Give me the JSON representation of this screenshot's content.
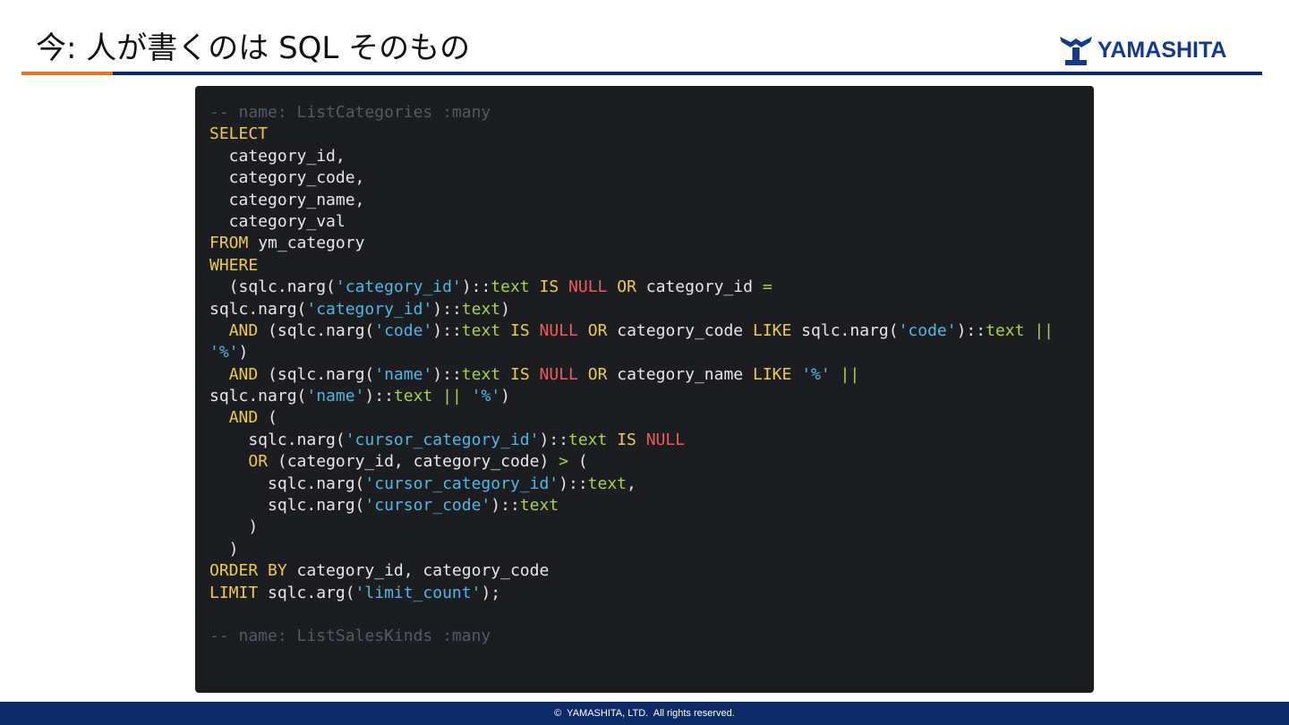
{
  "slide": {
    "title": "今: 人が書くのは SQL そのもの",
    "logo_text": "YAMASHITA",
    "logo_icon": "yamashita-logo-icon"
  },
  "footer": {
    "copyright": "©  YAMASHITA, LTD.  All rights reserved."
  },
  "colors": {
    "header_rule": "#0c2a66",
    "header_accent": "#e8731e",
    "code_background": "#1b1d20",
    "footer_background": "#0c2a66"
  },
  "code": {
    "language": "sql",
    "lines": [
      [
        {
          "t": "-- name: ListCategories :many",
          "k": "comment"
        }
      ],
      [
        {
          "t": "SELECT",
          "k": "keyword"
        }
      ],
      [
        {
          "t": "  category_id,",
          "k": "plain"
        }
      ],
      [
        {
          "t": "  category_code,",
          "k": "plain"
        }
      ],
      [
        {
          "t": "  category_name,",
          "k": "plain"
        }
      ],
      [
        {
          "t": "  category_val",
          "k": "plain"
        }
      ],
      [
        {
          "t": "FROM",
          "k": "keyword"
        },
        {
          "t": " ym_category",
          "k": "plain"
        }
      ],
      [
        {
          "t": "WHERE",
          "k": "keyword"
        }
      ],
      [
        {
          "t": "  (sqlc.narg(",
          "k": "plain"
        },
        {
          "t": "'category_id'",
          "k": "string"
        },
        {
          "t": ")::",
          "k": "plain"
        },
        {
          "t": "text",
          "k": "type"
        },
        {
          "t": " ",
          "k": "plain"
        },
        {
          "t": "IS",
          "k": "keyword"
        },
        {
          "t": " ",
          "k": "plain"
        },
        {
          "t": "NULL",
          "k": "null"
        },
        {
          "t": " ",
          "k": "plain"
        },
        {
          "t": "OR",
          "k": "keyword"
        },
        {
          "t": " category_id ",
          "k": "plain"
        },
        {
          "t": "=",
          "k": "operator"
        }
      ],
      [
        {
          "t": "sqlc.narg(",
          "k": "plain"
        },
        {
          "t": "'category_id'",
          "k": "string"
        },
        {
          "t": ")::",
          "k": "plain"
        },
        {
          "t": "text",
          "k": "type"
        },
        {
          "t": ")",
          "k": "plain"
        }
      ],
      [
        {
          "t": "  ",
          "k": "plain"
        },
        {
          "t": "AND",
          "k": "keyword"
        },
        {
          "t": " (sqlc.narg(",
          "k": "plain"
        },
        {
          "t": "'code'",
          "k": "string"
        },
        {
          "t": ")::",
          "k": "plain"
        },
        {
          "t": "text",
          "k": "type"
        },
        {
          "t": " ",
          "k": "plain"
        },
        {
          "t": "IS",
          "k": "keyword"
        },
        {
          "t": " ",
          "k": "plain"
        },
        {
          "t": "NULL",
          "k": "null"
        },
        {
          "t": " ",
          "k": "plain"
        },
        {
          "t": "OR",
          "k": "keyword"
        },
        {
          "t": " category_code ",
          "k": "plain"
        },
        {
          "t": "LIKE",
          "k": "keyword"
        },
        {
          "t": " sqlc.narg(",
          "k": "plain"
        },
        {
          "t": "'code'",
          "k": "string"
        },
        {
          "t": ")::",
          "k": "plain"
        },
        {
          "t": "text",
          "k": "type"
        },
        {
          "t": " ",
          "k": "plain"
        },
        {
          "t": "||",
          "k": "operator"
        }
      ],
      [
        {
          "t": "'%'",
          "k": "string"
        },
        {
          "t": ")",
          "k": "plain"
        }
      ],
      [
        {
          "t": "  ",
          "k": "plain"
        },
        {
          "t": "AND",
          "k": "keyword"
        },
        {
          "t": " (sqlc.narg(",
          "k": "plain"
        },
        {
          "t": "'name'",
          "k": "string"
        },
        {
          "t": ")::",
          "k": "plain"
        },
        {
          "t": "text",
          "k": "type"
        },
        {
          "t": " ",
          "k": "plain"
        },
        {
          "t": "IS",
          "k": "keyword"
        },
        {
          "t": " ",
          "k": "plain"
        },
        {
          "t": "NULL",
          "k": "null"
        },
        {
          "t": " ",
          "k": "plain"
        },
        {
          "t": "OR",
          "k": "keyword"
        },
        {
          "t": " category_name ",
          "k": "plain"
        },
        {
          "t": "LIKE",
          "k": "keyword"
        },
        {
          "t": " ",
          "k": "plain"
        },
        {
          "t": "'%'",
          "k": "string"
        },
        {
          "t": " ",
          "k": "plain"
        },
        {
          "t": "||",
          "k": "operator"
        }
      ],
      [
        {
          "t": "sqlc.narg(",
          "k": "plain"
        },
        {
          "t": "'name'",
          "k": "string"
        },
        {
          "t": ")::",
          "k": "plain"
        },
        {
          "t": "text",
          "k": "type"
        },
        {
          "t": " ",
          "k": "plain"
        },
        {
          "t": "||",
          "k": "operator"
        },
        {
          "t": " ",
          "k": "plain"
        },
        {
          "t": "'%'",
          "k": "string"
        },
        {
          "t": ")",
          "k": "plain"
        }
      ],
      [
        {
          "t": "  ",
          "k": "plain"
        },
        {
          "t": "AND",
          "k": "keyword"
        },
        {
          "t": " (",
          "k": "plain"
        }
      ],
      [
        {
          "t": "    sqlc.narg(",
          "k": "plain"
        },
        {
          "t": "'cursor_category_id'",
          "k": "string"
        },
        {
          "t": ")::",
          "k": "plain"
        },
        {
          "t": "text",
          "k": "type"
        },
        {
          "t": " ",
          "k": "plain"
        },
        {
          "t": "IS",
          "k": "keyword"
        },
        {
          "t": " ",
          "k": "plain"
        },
        {
          "t": "NULL",
          "k": "null"
        }
      ],
      [
        {
          "t": "    ",
          "k": "plain"
        },
        {
          "t": "OR",
          "k": "keyword"
        },
        {
          "t": " (category_id, category_code) ",
          "k": "plain"
        },
        {
          "t": ">",
          "k": "operator"
        },
        {
          "t": " (",
          "k": "plain"
        }
      ],
      [
        {
          "t": "      sqlc.narg(",
          "k": "plain"
        },
        {
          "t": "'cursor_category_id'",
          "k": "string"
        },
        {
          "t": ")::",
          "k": "plain"
        },
        {
          "t": "text",
          "k": "type"
        },
        {
          "t": ",",
          "k": "plain"
        }
      ],
      [
        {
          "t": "      sqlc.narg(",
          "k": "plain"
        },
        {
          "t": "'cursor_code'",
          "k": "string"
        },
        {
          "t": ")::",
          "k": "plain"
        },
        {
          "t": "text",
          "k": "type"
        }
      ],
      [
        {
          "t": "    )",
          "k": "plain"
        }
      ],
      [
        {
          "t": "  )",
          "k": "plain"
        }
      ],
      [
        {
          "t": "ORDER BY",
          "k": "keyword"
        },
        {
          "t": " category_id, category_code",
          "k": "plain"
        }
      ],
      [
        {
          "t": "LIMIT",
          "k": "keyword"
        },
        {
          "t": " sqlc.arg(",
          "k": "plain"
        },
        {
          "t": "'limit_count'",
          "k": "string"
        },
        {
          "t": ");",
          "k": "plain"
        }
      ],
      [],
      [
        {
          "t": "-- name: ListSalesKinds :many",
          "k": "comment"
        }
      ]
    ]
  }
}
